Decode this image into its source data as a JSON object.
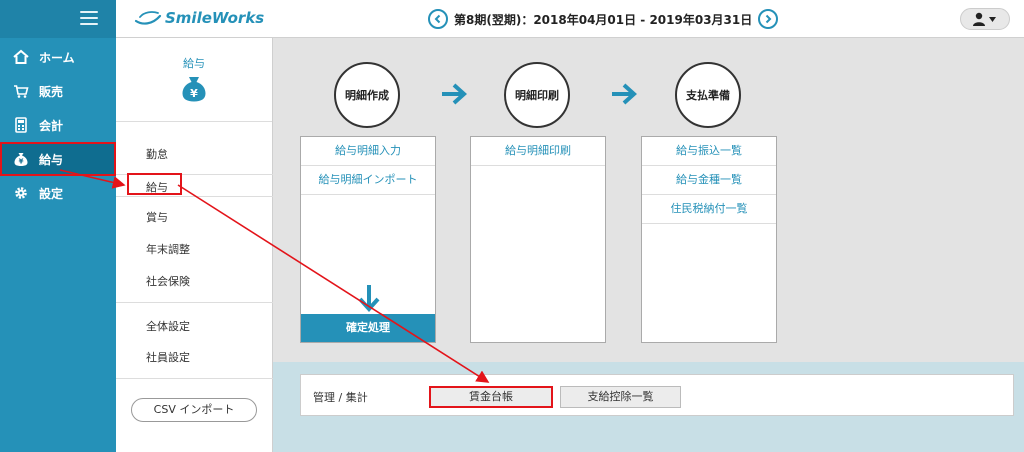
{
  "app": {
    "logo_text": "SmileWorks"
  },
  "header": {
    "period": "第8期(翌期)：2018年04月01日 - 2019年03月31日",
    "prev_icon": "chevron-left-circle-icon",
    "next_icon": "chevron-right-circle-icon",
    "user_icon": "user-dropdown-icon"
  },
  "nav": {
    "items": [
      {
        "label": "ホーム",
        "icon": "home-icon"
      },
      {
        "label": "販売",
        "icon": "cart-icon"
      },
      {
        "label": "会計",
        "icon": "calculator-icon"
      },
      {
        "label": "給与",
        "icon": "money-bag-icon"
      },
      {
        "label": "設定",
        "icon": "gear-icon"
      }
    ]
  },
  "subnav": {
    "title": "給与",
    "items": [
      "勤怠",
      "給与",
      "賞与",
      "年末調整",
      "社会保険",
      "全体設定",
      "社員設定"
    ],
    "csv_button": "CSV インポート"
  },
  "workflow": {
    "steps": [
      "明細作成",
      "明細印刷",
      "支払準備"
    ],
    "panels": [
      {
        "links": [
          "給与明細入力",
          "給与明細インポート"
        ],
        "action": "確定処理"
      },
      {
        "links": [
          "給与明細印刷"
        ]
      },
      {
        "links": [
          "給与振込一覧",
          "給与金種一覧",
          "住民税納付一覧"
        ]
      }
    ]
  },
  "management": {
    "label": "管理 / 集計",
    "buttons": [
      "賃金台帳",
      "支給控除一覧"
    ]
  },
  "colors": {
    "accent": "#2591b8",
    "highlight": "#e3141a"
  }
}
